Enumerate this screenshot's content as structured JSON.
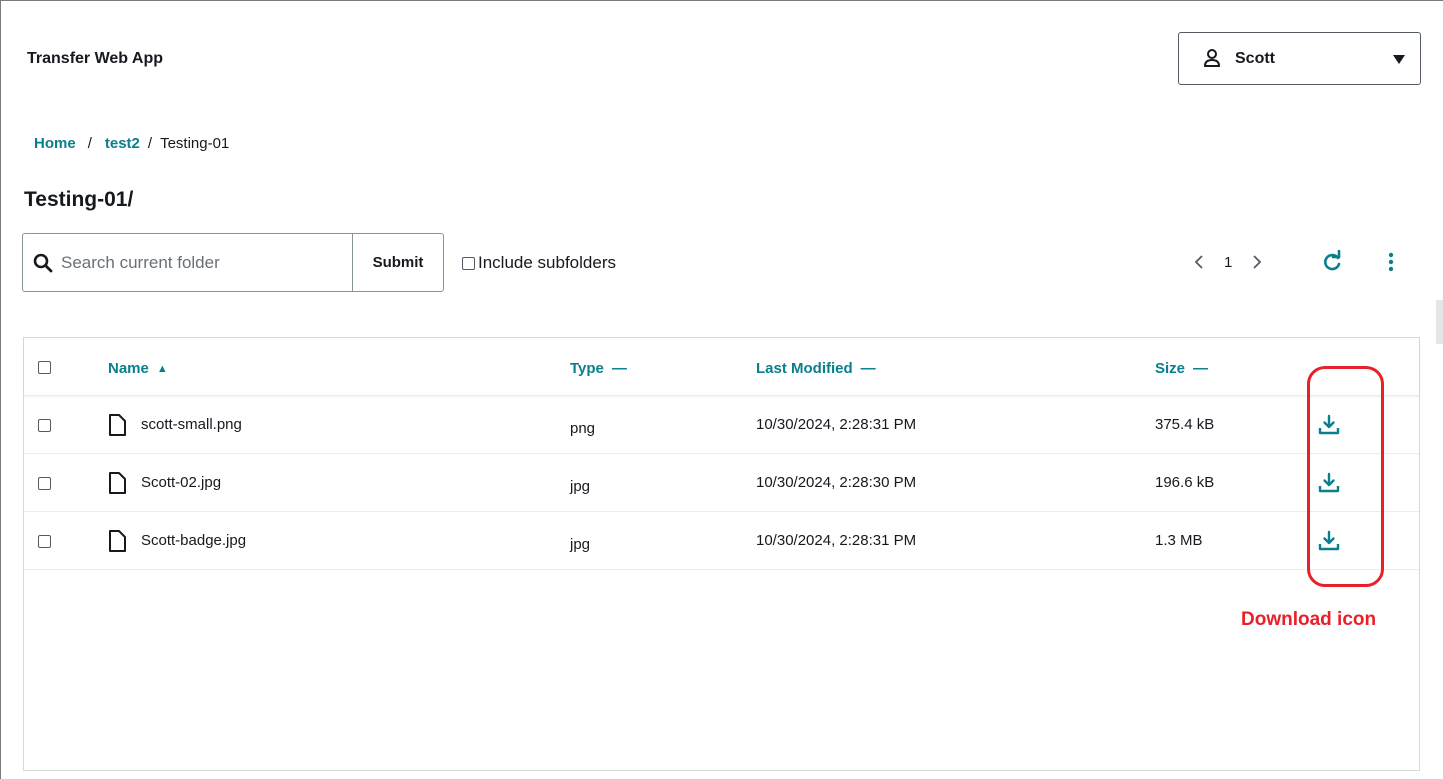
{
  "header": {
    "app_title": "Transfer Web App"
  },
  "user_menu": {
    "name": "Scott",
    "icon": "user-icon",
    "caret_icon": "caret-down-icon"
  },
  "breadcrumb": {
    "items": [
      {
        "label": "Home",
        "link": true
      },
      {
        "label": "test2",
        "link": true
      },
      {
        "label": "Testing-01",
        "link": false
      }
    ],
    "separator": "/"
  },
  "page_title": "Testing-01/",
  "search": {
    "placeholder": "Search current folder",
    "value": "",
    "submit_label": "Submit",
    "icon": "search-icon"
  },
  "include_subfolders": {
    "label": "Include subfolders",
    "checked": false
  },
  "pagination": {
    "current_page": "1",
    "prev_icon": "chevron-left-icon",
    "next_icon": "chevron-right-icon"
  },
  "toolbar": {
    "refresh_icon": "refresh-icon",
    "more_icon": "kebab-menu-icon"
  },
  "table": {
    "columns": [
      {
        "label": "Name",
        "sort": "▲"
      },
      {
        "label": "Type",
        "sort": "—"
      },
      {
        "label": "Last Modified",
        "sort": "—"
      },
      {
        "label": "Size",
        "sort": "—"
      }
    ],
    "rows": [
      {
        "name": "scott-small.png",
        "type": "png",
        "modified": "10/30/2024, 2:28:31 PM",
        "size": "375.4 kB"
      },
      {
        "name": "Scott-02.jpg",
        "type": "jpg",
        "modified": "10/30/2024, 2:28:30 PM",
        "size": "196.6 kB"
      },
      {
        "name": "Scott-badge.jpg",
        "type": "jpg",
        "modified": "10/30/2024, 2:28:31 PM",
        "size": "1.3 MB"
      }
    ],
    "row_icon": "file-icon",
    "action_icon": "download-icon"
  },
  "annotation": {
    "label": "Download icon",
    "color": "#e8202a"
  },
  "colors": {
    "accent": "#0a7f8d",
    "text": "#16191f",
    "border": "#879596"
  }
}
